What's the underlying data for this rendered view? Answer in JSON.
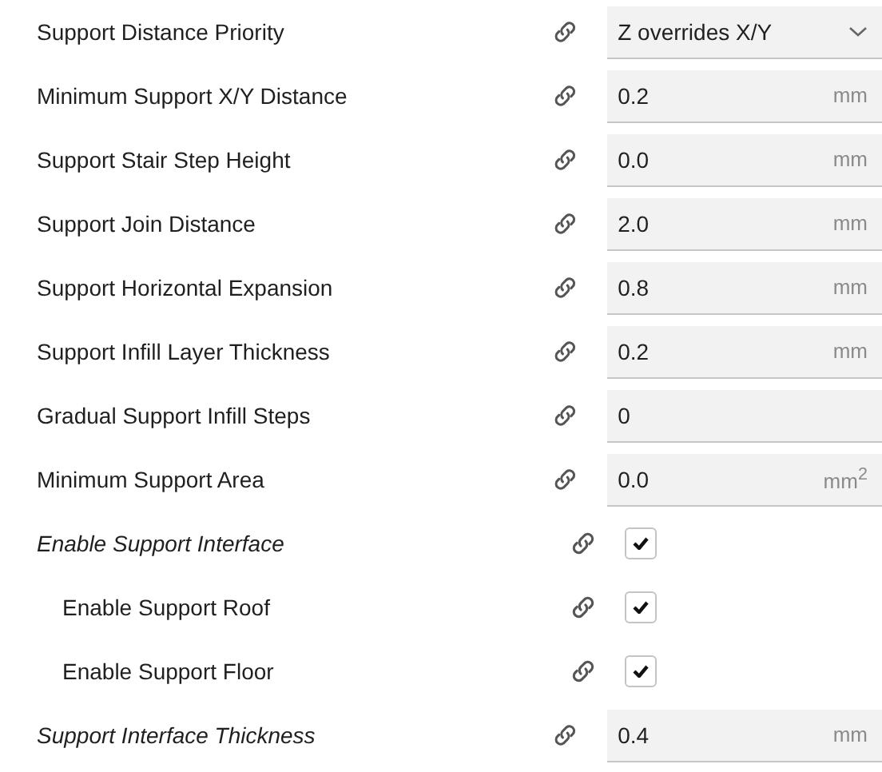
{
  "settings": [
    {
      "label": "Support Distance Priority",
      "kind": "dropdown",
      "value": "Z overrides X/Y",
      "italic": false
    },
    {
      "label": "Minimum Support X/Y Distance",
      "kind": "number",
      "value": "0.2",
      "unit": "mm",
      "italic": false
    },
    {
      "label": "Support Stair Step Height",
      "kind": "number",
      "value": "0.0",
      "unit": "mm",
      "italic": false
    },
    {
      "label": "Support Join Distance",
      "kind": "number",
      "value": "2.0",
      "unit": "mm",
      "italic": false
    },
    {
      "label": "Support Horizontal Expansion",
      "kind": "number",
      "value": "0.8",
      "unit": "mm",
      "italic": false
    },
    {
      "label": "Support Infill Layer Thickness",
      "kind": "number",
      "value": "0.2",
      "unit": "mm",
      "italic": false
    },
    {
      "label": "Gradual Support Infill Steps",
      "kind": "number",
      "value": "0",
      "italic": false
    },
    {
      "label": "Minimum Support Area",
      "kind": "number",
      "value": "0.0",
      "unit": "mm$^{2}$",
      "italic": false
    },
    {
      "label": "Enable Support Interface",
      "kind": "checkbox",
      "checked": true,
      "italic": true,
      "children": [
        {
          "label": "Enable Support Roof",
          "kind": "checkbox",
          "checked": true,
          "italic": false
        },
        {
          "label": "Enable Support Floor",
          "kind": "checkbox",
          "checked": true,
          "italic": false
        }
      ]
    },
    {
      "label": "Support Interface Thickness",
      "kind": "number",
      "value": "0.4",
      "unit": "mm",
      "italic": true
    }
  ]
}
